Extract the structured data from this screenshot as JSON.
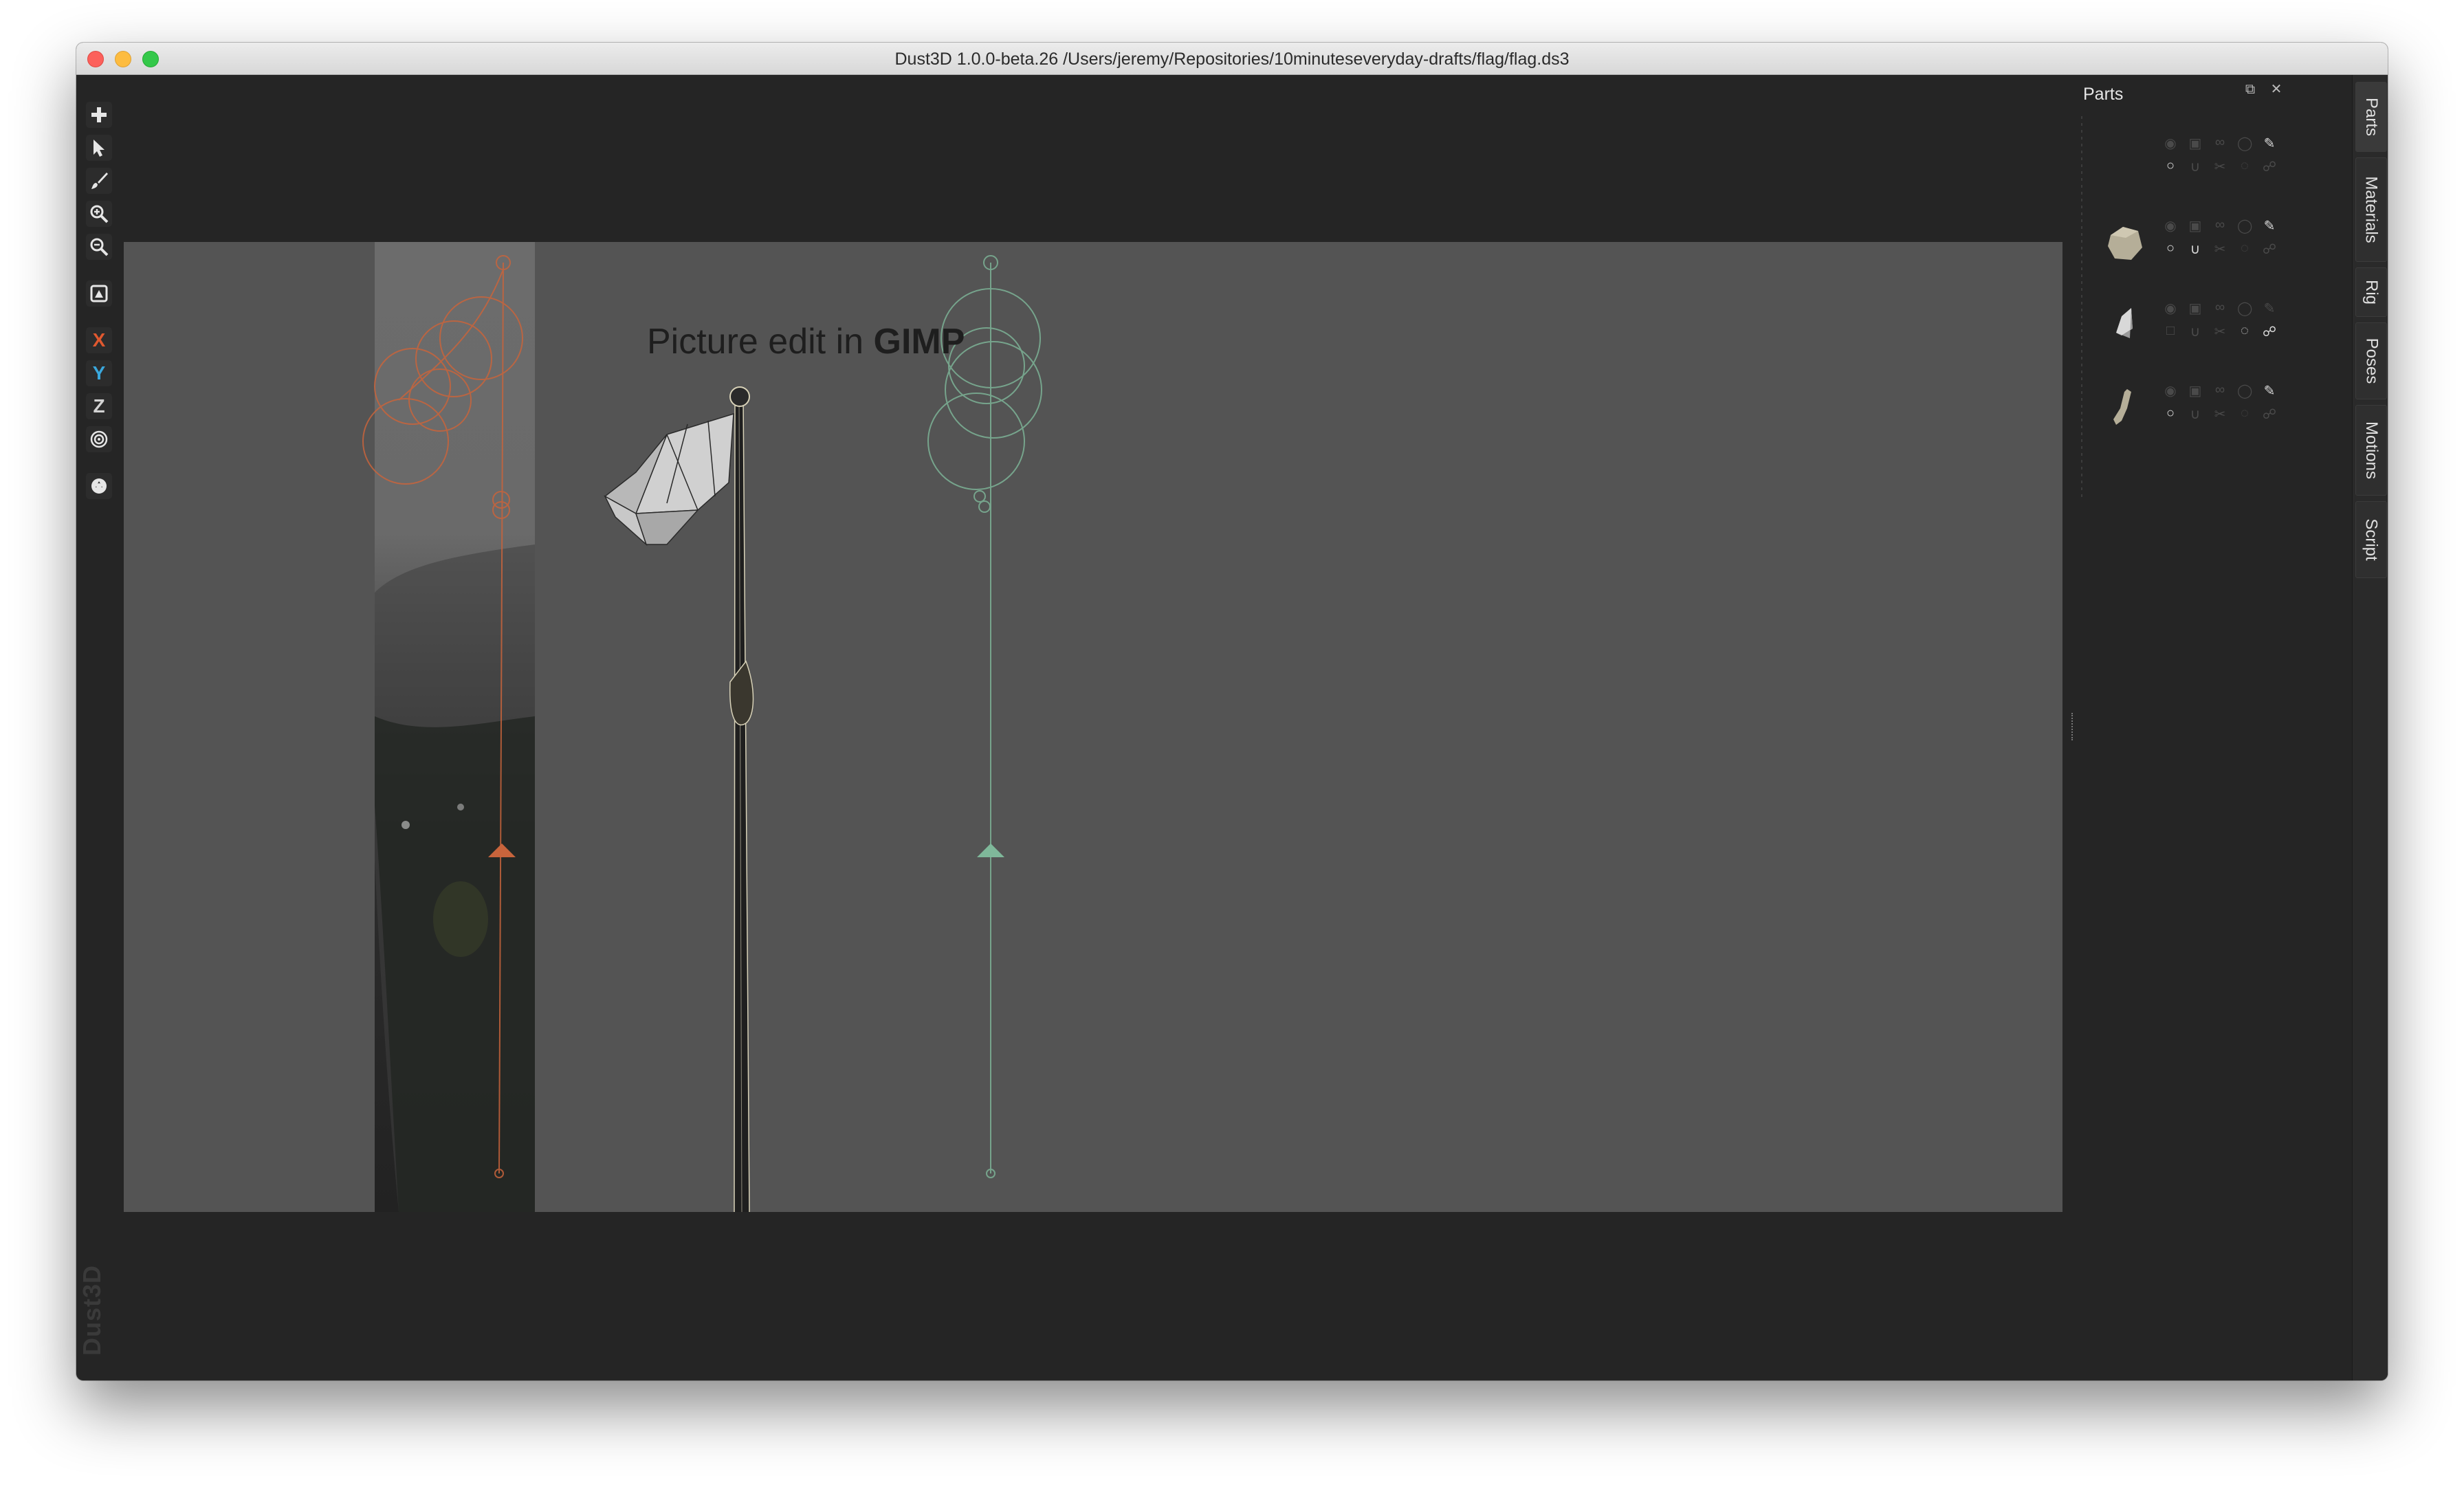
{
  "window": {
    "title": "Dust3D 1.0.0-beta.26 /Users/jeremy/Repositories/10minuteseveryday-drafts/flag/flag.ds3"
  },
  "toolbar": {
    "tools": [
      {
        "name": "add",
        "icon": "plus-icon"
      },
      {
        "name": "select",
        "icon": "pointer-icon"
      },
      {
        "name": "paint",
        "icon": "brush-icon"
      },
      {
        "name": "zoom-in",
        "icon": "zoom-in-icon"
      },
      {
        "name": "zoom-out",
        "icon": "zoom-out-icon"
      },
      {
        "name": "camera",
        "icon": "reset-view-icon"
      },
      {
        "name": "radius",
        "icon": "radius-icon"
      },
      {
        "name": "regenerate",
        "icon": "recycle-icon"
      }
    ],
    "axis_x": "X",
    "axis_y": "Y",
    "axis_z": "Z",
    "axis_colors": {
      "x": "#e0582f",
      "y": "#3aa7dc",
      "z": "#d4d4d4"
    }
  },
  "viewport": {
    "overlay_text_plain": "Picture edit in ",
    "overlay_text_bold": "GIMP"
  },
  "parts_panel": {
    "title": "Parts",
    "float_icon": "float-icon",
    "close_icon": "close-icon"
  },
  "tabs": [
    "Parts",
    "Materials",
    "Rig",
    "Poses",
    "Motions",
    "Script"
  ],
  "logo": "Dust3D",
  "colors": {
    "front_view": "#c8643c",
    "side_view": "#7fb89a",
    "background": "#252525",
    "viewport": "#545454"
  }
}
